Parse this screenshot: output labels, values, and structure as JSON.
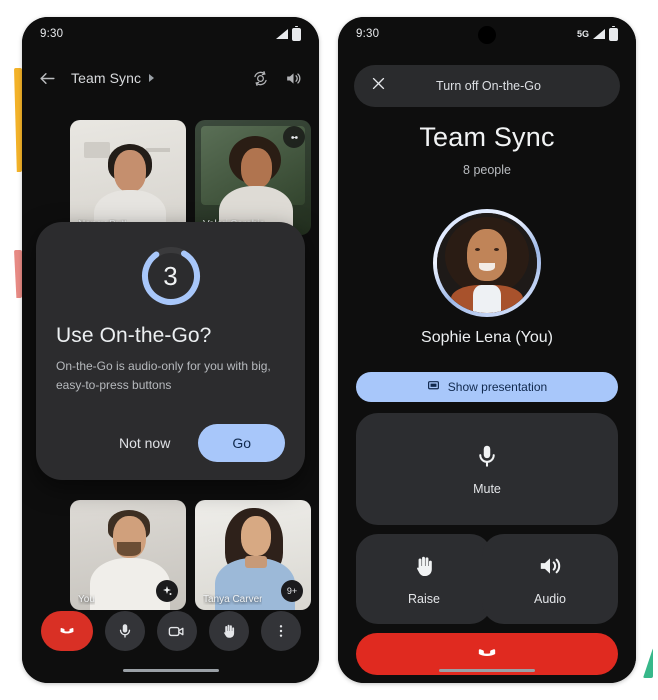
{
  "page": {
    "background": "#ffffff",
    "accents": {
      "yellow": "#f3b229",
      "pink": "#e78a84",
      "green": "#37b88a"
    }
  },
  "left_phone": {
    "status_bar": {
      "time": "9:30",
      "signal_icon": "signal-bars-icon",
      "battery_icon": "battery-icon"
    },
    "header": {
      "back_icon": "back-arrow-icon",
      "title": "Team Sync",
      "expand_icon": "caret-right-icon",
      "switch_camera_icon": "switch-camera-icon",
      "audio_icon": "speaker-icon"
    },
    "tiles": [
      {
        "name": "Nancy Butt",
        "badge": "",
        "more_icon": "more-vert-icon"
      },
      {
        "name": "Valeri Sarabia",
        "badge": "effects-icon",
        "more_icon": ""
      },
      {
        "name": "You",
        "badge": "sparkle-icon",
        "more_icon": ""
      },
      {
        "name": "Tanya Carver",
        "badge": "9+",
        "more_icon": ""
      }
    ],
    "dialog": {
      "countdown": "3",
      "countdown_ring_color": "#a8c7fa",
      "title": "Use On-the-Go?",
      "body": "On-the-Go is audio-only for you with big, easy-to-press buttons",
      "secondary_label": "Not now",
      "primary_label": "Go",
      "primary_color": "#a8c7fa"
    },
    "controls": [
      {
        "name": "end-call",
        "icon": "phone-hangup-icon",
        "color": "#d93025"
      },
      {
        "name": "microphone",
        "icon": "microphone-icon",
        "color": "#333438"
      },
      {
        "name": "camera",
        "icon": "video-camera-icon",
        "color": "#333438"
      },
      {
        "name": "raise-hand",
        "icon": "raised-hand-icon",
        "color": "#333438"
      },
      {
        "name": "more-options",
        "icon": "more-vert-icon",
        "color": "#333438"
      }
    ]
  },
  "right_phone": {
    "status_bar": {
      "time": "9:30",
      "network": "5G",
      "signal_icon": "signal-bars-icon",
      "battery_icon": "battery-icon"
    },
    "banner": {
      "close_icon": "close-x-icon",
      "label": "Turn off On-the-Go"
    },
    "meeting": {
      "title": "Team Sync",
      "participants": "8 people",
      "speaker_name": "Sophie Lena (You)"
    },
    "present_button": {
      "icon": "present-screen-icon",
      "label": "Show presentation",
      "color": "#a8c7fa"
    },
    "buttons": [
      {
        "key": "mute",
        "icon": "microphone-icon",
        "label": "Mute"
      },
      {
        "key": "raise",
        "icon": "raised-hand-icon",
        "label": "Raise"
      },
      {
        "key": "audio",
        "icon": "speaker-icon",
        "label": "Audio"
      }
    ],
    "end_call": {
      "icon": "phone-hangup-icon",
      "color": "#e02a20"
    }
  }
}
